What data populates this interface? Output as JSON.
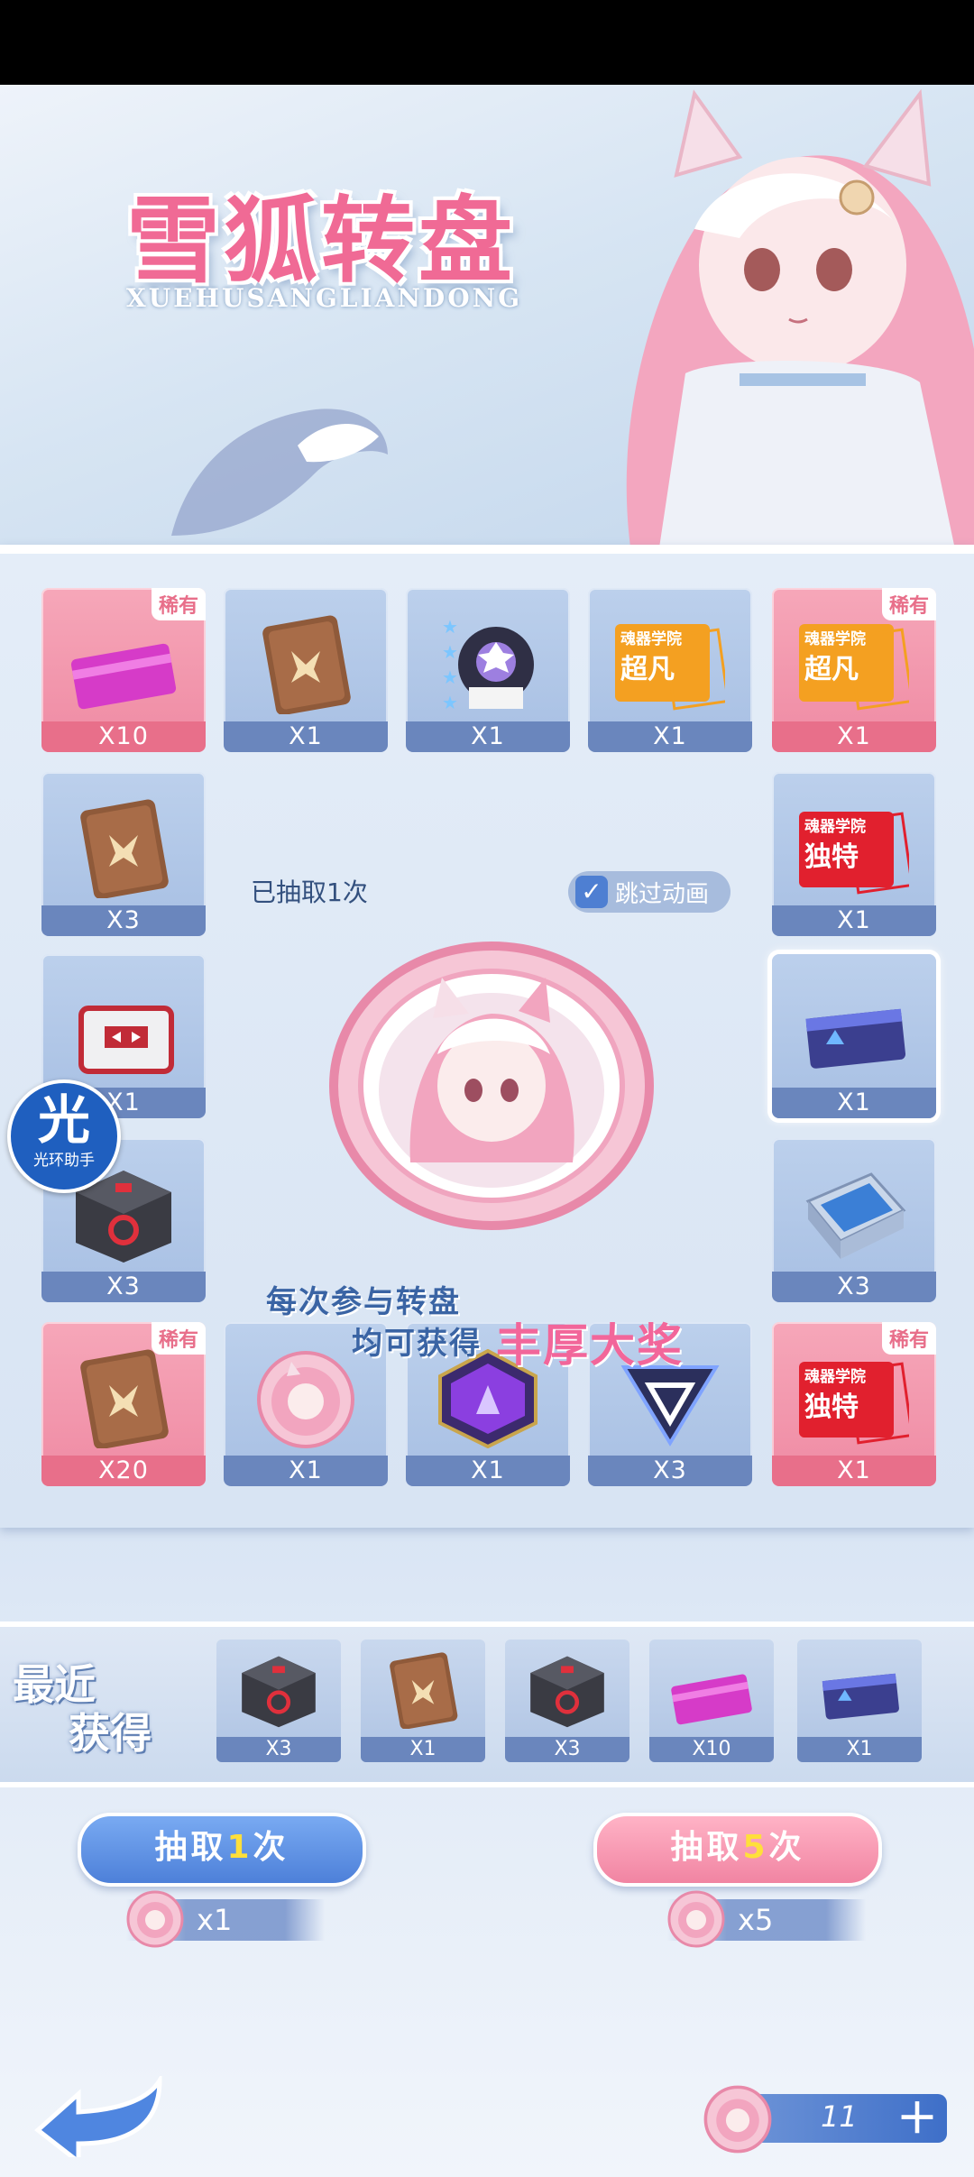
{
  "title": "雪狐转盘",
  "subtitle": "XUEHUSANGLIANDONG",
  "rare_badge": "稀有",
  "drawn_count_text": "已抽取1次",
  "skip_animation_label": "跳过动画",
  "skip_animation_checked": true,
  "promo": {
    "line1": "每次参与转盘",
    "line2": "均可获得",
    "highlight": "丰厚大奖"
  },
  "helper": {
    "glyph": "光",
    "label": "光环助手"
  },
  "grid_items": [
    {
      "icon": "pink-card-icon",
      "qty": "X10",
      "rare": true
    },
    {
      "icon": "chocolate-token-icon",
      "qty": "X1",
      "rare": false
    },
    {
      "icon": "character-portrait-icon",
      "qty": "X1",
      "rare": false
    },
    {
      "icon": "orange-super-card-icon",
      "qty": "X1",
      "rare": false,
      "card_top": "魂器学院",
      "card_label": "超凡"
    },
    {
      "icon": "orange-super-card-icon",
      "qty": "X1",
      "rare": true,
      "card_top": "魂器学院",
      "card_label": "超凡"
    },
    {
      "icon": "chocolate-token-icon",
      "qty": "X3",
      "rare": false
    },
    {
      "icon": "red-unique-card-icon",
      "qty": "X1",
      "rare": false,
      "card_top": "魂器学院",
      "card_label": "独特"
    },
    {
      "icon": "reward-chest-icon",
      "qty": "X1",
      "rare": false
    },
    {
      "icon": "blue-folder-card-icon",
      "qty": "X1",
      "rare": false,
      "selected": true
    },
    {
      "icon": "dark-cube-icon",
      "qty": "X3",
      "rare": false
    },
    {
      "icon": "blue-case-icon",
      "qty": "X3",
      "rare": false
    },
    {
      "icon": "chocolate-token-icon",
      "qty": "X20",
      "rare": true
    },
    {
      "icon": "fox-coin-icon",
      "qty": "X1",
      "rare": false
    },
    {
      "icon": "purple-hexagon-icon",
      "qty": "X1",
      "rare": false
    },
    {
      "icon": "triangle-emblem-icon",
      "qty": "X3",
      "rare": false
    },
    {
      "icon": "red-unique-card-icon",
      "qty": "X1",
      "rare": true,
      "card_top": "魂器学院",
      "card_label": "独特"
    }
  ],
  "recent": {
    "label_line1": "最近",
    "label_line2": "获得",
    "items": [
      {
        "icon": "dark-cube-icon",
        "qty": "X3"
      },
      {
        "icon": "chocolate-token-icon",
        "qty": "X1"
      },
      {
        "icon": "dark-cube-icon",
        "qty": "X3"
      },
      {
        "icon": "pink-card-icon",
        "qty": "X10"
      },
      {
        "icon": "blue-folder-card-icon",
        "qty": "X1"
      }
    ]
  },
  "draw_buttons": [
    {
      "prefix": "抽取",
      "count": "1",
      "suffix": "次",
      "cost": "x1",
      "style": "blue"
    },
    {
      "prefix": "抽取",
      "count": "5",
      "suffix": "次",
      "cost": "x5",
      "style": "pink"
    }
  ],
  "coin_count": "11",
  "colors": {
    "rare": "#ef8aa3",
    "normal": "#a7bfe3",
    "title": "#f06a95",
    "button_blue": "#4d80d9",
    "button_pink": "#f184a2"
  }
}
